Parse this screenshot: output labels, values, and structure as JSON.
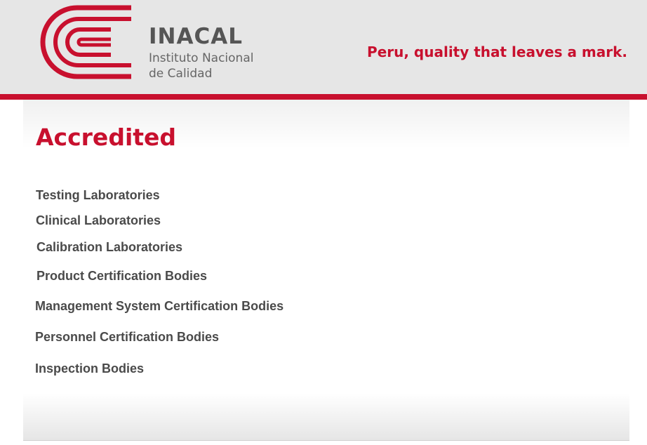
{
  "header": {
    "brand_name": "INACAL",
    "brand_sub_line1": "Instituto Nacional",
    "brand_sub_line2": "de Calidad",
    "tagline": "Peru, quality that leaves a mark.",
    "logo_icon": "inacal-logo-icon",
    "colors": {
      "accent": "#c8102e",
      "header_bg": "#e6e6e6",
      "text_gray": "#555555"
    }
  },
  "main": {
    "title": "Accredited",
    "items": [
      {
        "label": "Testing Laboratories"
      },
      {
        "label": "Clinical Laboratories"
      },
      {
        "label": "Calibration Laboratories"
      },
      {
        "label": "Product Certification Bodies"
      },
      {
        "label": "Management System Certification Bodies"
      },
      {
        "label": "Personnel Certification Bodies"
      },
      {
        "label": "Inspection Bodies"
      }
    ]
  }
}
